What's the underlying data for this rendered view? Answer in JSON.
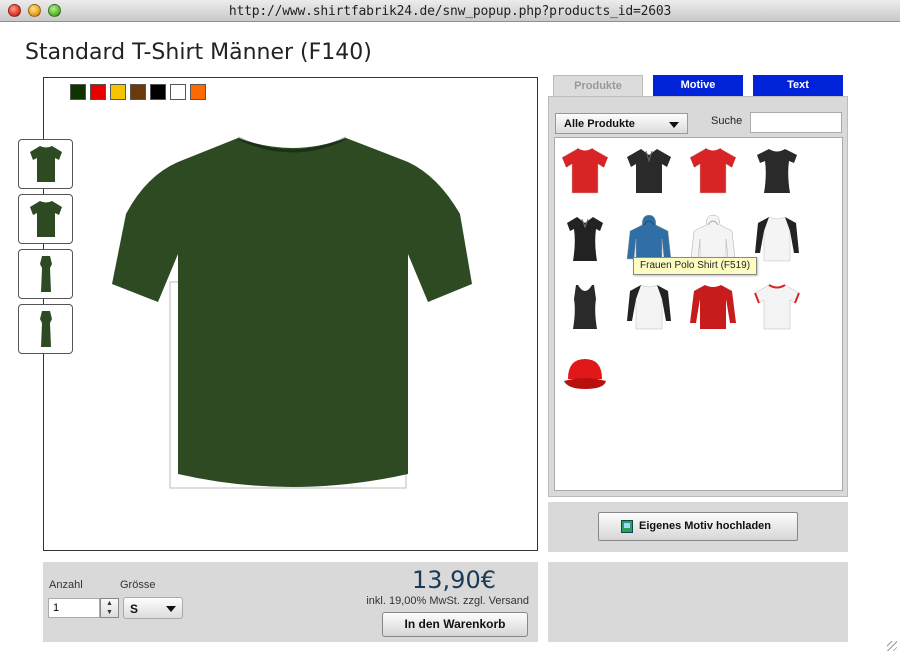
{
  "browser": {
    "url": "http://www.shirtfabrik24.de/snw_popup.php?products_id=2603"
  },
  "product": {
    "title": "Standard T-Shirt Männer  (F140)",
    "main_color": "#2d4a23"
  },
  "swatches": [
    "#0f3300",
    "#e60000",
    "#f5c300",
    "#6b3a0a",
    "#000000",
    "#ffffff",
    "#ff6a00"
  ],
  "thumbnails": [
    "front-view",
    "back-view",
    "left-side-view",
    "right-side-view"
  ],
  "order": {
    "quantity_label": "Anzahl",
    "quantity_value": "1",
    "size_label": "Grösse",
    "size_value": "S",
    "price": "13,90€",
    "vat_note": "inkl. 19,00% MwSt. zzgl. Versand",
    "cart_button": "In den Warenkorb"
  },
  "tabs": [
    "Produkte",
    "Motive",
    "Text"
  ],
  "filter": {
    "category": "Alle Produkte",
    "search_label": "Suche",
    "search_value": ""
  },
  "tooltip": "Frauen Polo Shirt (F519)",
  "upload_button": "Eigenes Motiv hochladen",
  "products": [
    {
      "kind": "tshirt",
      "color": "#d82424",
      "trim": "#d82424"
    },
    {
      "kind": "polo",
      "color": "#2a2a2a",
      "trim": "#2a2a2a"
    },
    {
      "kind": "tshirt",
      "color": "#d82424",
      "trim": "#d82424"
    },
    {
      "kind": "women-tshirt",
      "color": "#2a2a2a",
      "trim": "#2a2a2a"
    },
    {
      "kind": "women-polo",
      "color": "#222222",
      "trim": "#222222"
    },
    {
      "kind": "hoodie",
      "color": "#2f6fa6",
      "trim": "#2f6fa6"
    },
    {
      "kind": "hoodie",
      "color": "#f4f4f4",
      "trim": "#dddddd"
    },
    {
      "kind": "raglan-long",
      "color": "#f4f4f4",
      "trim": "#222222"
    },
    {
      "kind": "tank",
      "color": "#2a2a2a",
      "trim": "#2a2a2a"
    },
    {
      "kind": "raglan-long",
      "color": "#f4f4f4",
      "trim": "#222222"
    },
    {
      "kind": "longsleeve",
      "color": "#c81c1c",
      "trim": "#c81c1c"
    },
    {
      "kind": "ringer",
      "color": "#f4f4f4",
      "trim": "#d82424"
    },
    {
      "kind": "cap",
      "color": "#e01818",
      "trim": "#e01818"
    }
  ]
}
